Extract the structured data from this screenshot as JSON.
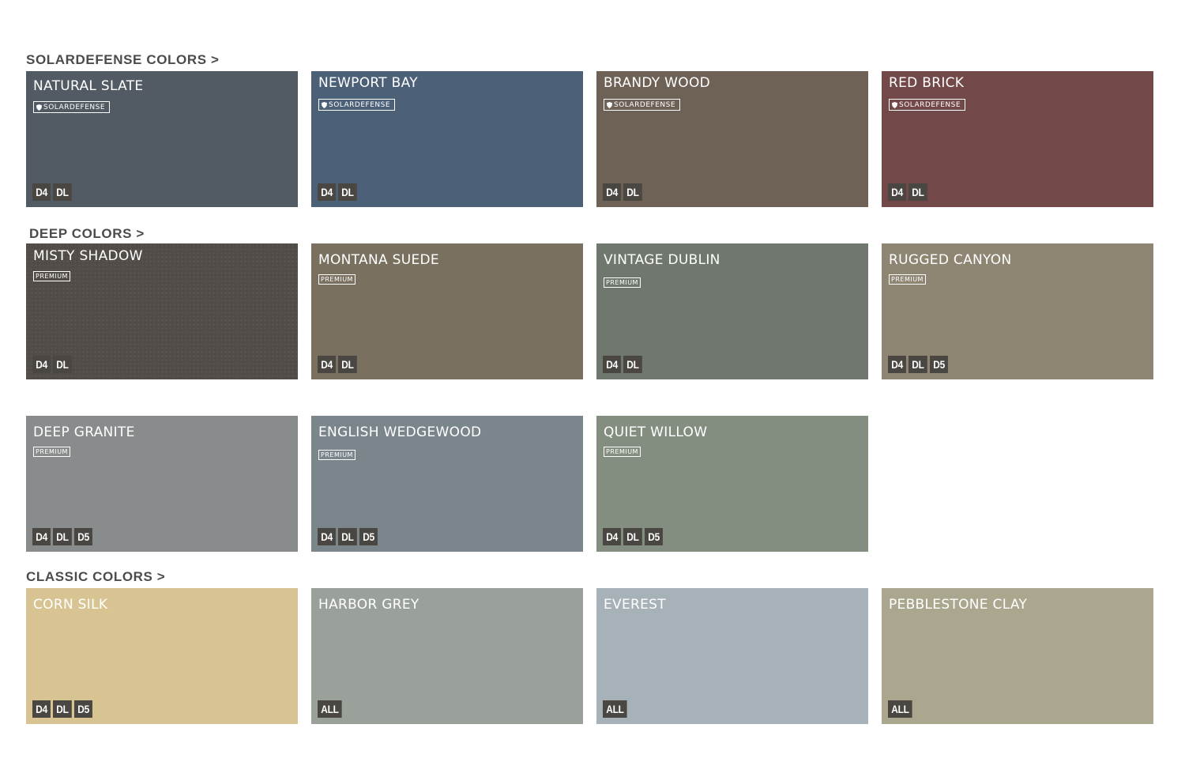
{
  "sections": {
    "solardefense": "SOLARDEFENSE COLORS >",
    "deep": "DEEP COLORS >",
    "classic": "CLASSIC COLORS >"
  },
  "tag_labels": {
    "solardefense": "SOLARDEFENSE",
    "premium": "PREMIUM"
  },
  "swatches": [
    {
      "name": "NATURAL SLATE",
      "color": "#525b63",
      "tag": "SOLARDEFENSE",
      "badges": [
        "D4",
        "DL"
      ]
    },
    {
      "name": "NEWPORT BAY",
      "color": "#4c6078",
      "tag": "SOLARDEFENSE",
      "badges": [
        "D4",
        "DL"
      ]
    },
    {
      "name": "BRANDY WOOD",
      "color": "#6e6257",
      "tag": "SOLARDEFENSE",
      "badges": [
        "D4",
        "DL"
      ]
    },
    {
      "name": "RED BRICK",
      "color": "#734848",
      "tag": "SOLARDEFENSE",
      "badges": [
        "D4",
        "DL"
      ]
    },
    {
      "name": "MISTY SHADOW",
      "color": "#514c47",
      "tag": "PREMIUM",
      "badges": [
        "D4",
        "DL"
      ]
    },
    {
      "name": "MONTANA SUEDE",
      "color": "#7a7060",
      "tag": "PREMIUM",
      "badges": [
        "D4",
        "DL"
      ]
    },
    {
      "name": "VINTAGE DUBLIN",
      "color": "#6f776e",
      "tag": "PREMIUM",
      "badges": [
        "D4",
        "DL"
      ]
    },
    {
      "name": "RUGGED CANYON",
      "color": "#8e8573",
      "tag": "PREMIUM",
      "badges": [
        "D4",
        "DL",
        "D5"
      ]
    },
    {
      "name": "DEEP GRANITE",
      "color": "#898c8c",
      "tag": "PREMIUM",
      "badges": [
        "D4",
        "DL",
        "D5"
      ]
    },
    {
      "name": "ENGLISH WEDGEWOOD",
      "color": "#7a868c",
      "tag": "PREMIUM",
      "badges": [
        "D4",
        "DL",
        "D5"
      ]
    },
    {
      "name": "QUIET WILLOW",
      "color": "#848e80",
      "tag": "PREMIUM",
      "badges": [
        "D4",
        "DL",
        "D5"
      ]
    },
    {
      "name": "CORN SILK",
      "color": "#d8c392",
      "tag": "",
      "badges": [
        "D4",
        "DL",
        "D5"
      ]
    },
    {
      "name": "HARBOR GREY",
      "color": "#9aa09a",
      "tag": "",
      "badges": [
        "ALL"
      ]
    },
    {
      "name": "EVEREST",
      "color": "#a6b2b8",
      "tag": "",
      "badges": [
        "ALL"
      ]
    },
    {
      "name": "PEBBLESTONE CLAY",
      "color": "#aba78f",
      "tag": "",
      "badges": [
        "ALL"
      ]
    }
  ]
}
